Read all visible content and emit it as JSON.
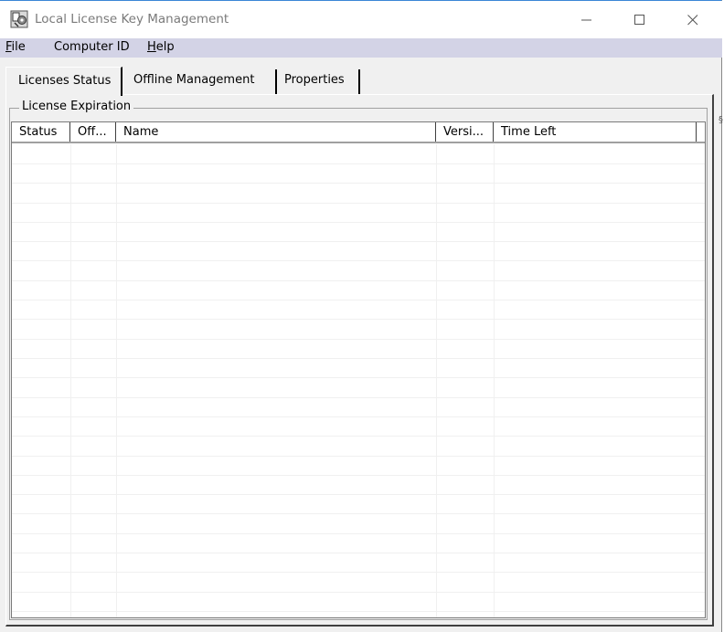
{
  "window": {
    "title": "Local License Key Management",
    "icon": "app-license-icon"
  },
  "menu": {
    "file": {
      "mnemonic": "F",
      "rest": "ile"
    },
    "computer_id": "Computer ID",
    "help": {
      "mnemonic": "H",
      "rest": "elp"
    }
  },
  "tabs": [
    {
      "label": "Licenses Status",
      "selected": true
    },
    {
      "label": "Offline Management",
      "selected": false
    },
    {
      "label": "Properties",
      "selected": false
    }
  ],
  "group": {
    "label": "License Expiration"
  },
  "table": {
    "columns": [
      "Status",
      "Off...",
      "Name",
      "Versi...",
      "Time Left"
    ],
    "rows": []
  },
  "colors": {
    "menubar_bg": "#d3d3e6",
    "window_bg": "#f0f0f0",
    "title_text": "#7a7a7a"
  }
}
